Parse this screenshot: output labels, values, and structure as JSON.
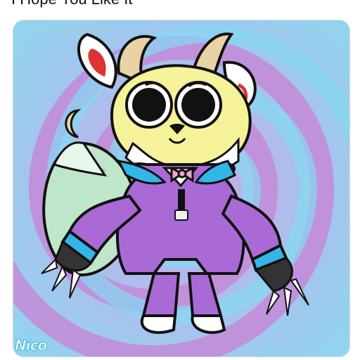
{
  "post": {
    "text": "I Hope You Like It"
  },
  "artwork": {
    "signature": "Nico",
    "colors": {
      "swirl_purple": "#c48ad8",
      "swirl_blue": "#86d8f2",
      "head_yellow": "#f6f29a",
      "horn_tan": "#e9d2a6",
      "jacket_purple": "#a96ad6",
      "cuff_blue": "#33b5e8",
      "tail_mint": "#bfe6c8",
      "bowtie_pink": "#f2a6c8"
    }
  }
}
